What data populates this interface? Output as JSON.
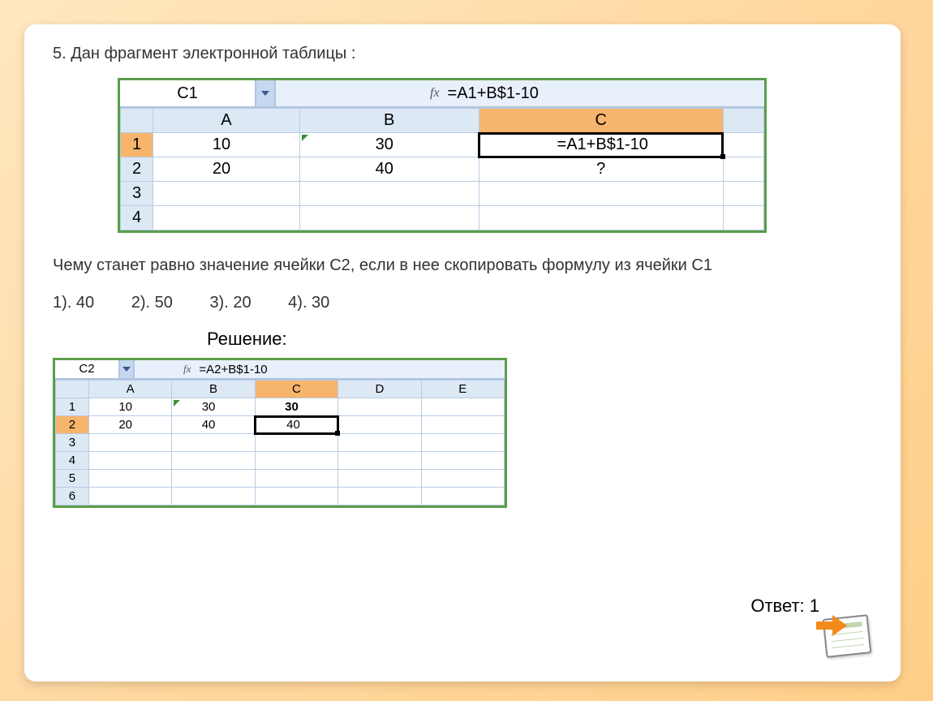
{
  "question_title": "5. Дан фрагмент электронной таблицы :",
  "fragment1": {
    "namebox": "C1",
    "fx_formula": "=А1+В$1-10",
    "cols": [
      "A",
      "B",
      "C"
    ],
    "rows": [
      {
        "num": "1",
        "a": "10",
        "b": "30",
        "c": "=А1+В$1-10"
      },
      {
        "num": "2",
        "a": "20",
        "b": "40",
        "c": "?"
      },
      {
        "num": "3",
        "a": "",
        "b": "",
        "c": ""
      },
      {
        "num": "4",
        "a": "",
        "b": "",
        "c": ""
      }
    ]
  },
  "question_text": "Чему станет равно значение ячейки С2, если в нее скопировать формулу из ячейки С1",
  "options": [
    {
      "label": "1). 40"
    },
    {
      "label": "2). 50"
    },
    {
      "label": "3). 20"
    },
    {
      "label": "4). 30"
    }
  ],
  "solution_label": "Решение:",
  "fragment2": {
    "namebox": "C2",
    "fx_formula": "=A2+B$1-10",
    "cols": [
      "A",
      "B",
      "C",
      "D",
      "E"
    ],
    "rows": [
      {
        "num": "1",
        "a": "10",
        "b": "30",
        "c": "30"
      },
      {
        "num": "2",
        "a": "20",
        "b": "40",
        "c": "40"
      },
      {
        "num": "3"
      },
      {
        "num": "4"
      },
      {
        "num": "5"
      },
      {
        "num": "6"
      }
    ]
  },
  "answer": "Ответ: 1",
  "fx_label": "fx"
}
